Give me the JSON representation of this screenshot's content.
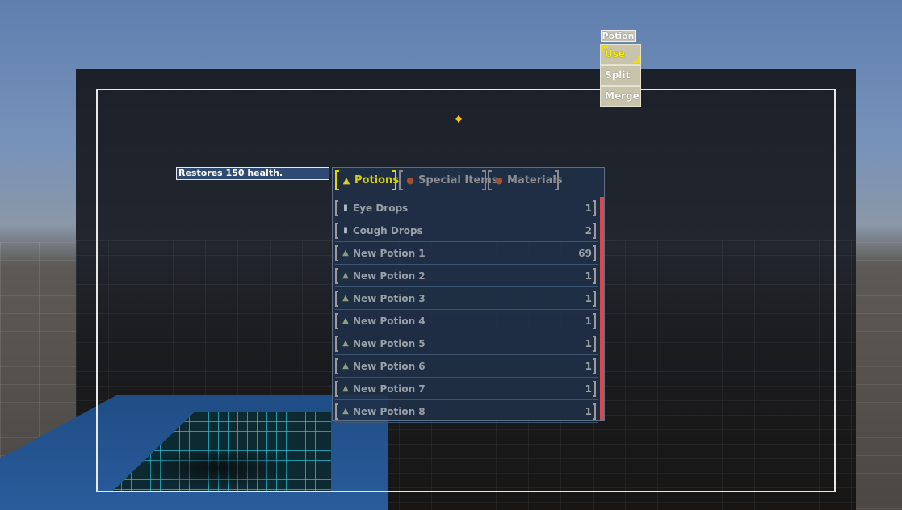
{
  "tooltip": {
    "text": "Restores 150 health."
  },
  "context_menu": {
    "title": "Potion",
    "items": [
      {
        "label": "Use",
        "active": true
      },
      {
        "label": "Split",
        "active": false
      },
      {
        "label": "Merge",
        "active": false
      }
    ]
  },
  "inventory": {
    "tabs": [
      {
        "label": "Potions",
        "icon": "potion-icon",
        "active": true
      },
      {
        "label": "Special Items",
        "icon": "bag-icon",
        "active": false
      },
      {
        "label": "Materials",
        "icon": "bag-icon",
        "active": false
      }
    ],
    "items": [
      {
        "name": "Eye Drops",
        "qty": "1",
        "icon": "vial-icon"
      },
      {
        "name": "Cough Drops",
        "qty": "2",
        "icon": "vial-icon"
      },
      {
        "name": "New Potion 1",
        "qty": "69",
        "icon": "potion-icon"
      },
      {
        "name": "New Potion 2",
        "qty": "1",
        "icon": "potion-icon"
      },
      {
        "name": "New Potion 3",
        "qty": "1",
        "icon": "potion-icon"
      },
      {
        "name": "New Potion 4",
        "qty": "1",
        "icon": "potion-icon"
      },
      {
        "name": "New Potion 5",
        "qty": "1",
        "icon": "potion-icon"
      },
      {
        "name": "New Potion 6",
        "qty": "1",
        "icon": "potion-icon"
      },
      {
        "name": "New Potion 7",
        "qty": "1",
        "icon": "potion-icon"
      },
      {
        "name": "New Potion 8",
        "qty": "1",
        "icon": "potion-icon"
      }
    ]
  },
  "colors": {
    "active_tab": "#d8d000",
    "context_active": "#f7f000",
    "scrollbar": "#d84a4a",
    "panel_bg": "#1f3048"
  }
}
